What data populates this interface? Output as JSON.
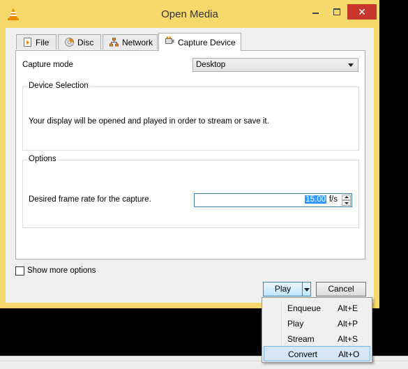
{
  "window": {
    "title": "Open Media"
  },
  "tabs": [
    {
      "label": "File",
      "icon": "file-play-icon"
    },
    {
      "label": "Disc",
      "icon": "disc-icon"
    },
    {
      "label": "Network",
      "icon": "network-icon"
    },
    {
      "label": "Capture Device",
      "icon": "capture-device-icon"
    }
  ],
  "capture": {
    "mode_label": "Capture mode",
    "mode_value": "Desktop",
    "device_selection_title": "Device Selection",
    "device_selection_text": "Your display will be opened and played in order to stream or save it.",
    "options_title": "Options",
    "frame_rate_label": "Desired frame rate for the capture.",
    "frame_rate_value": "15.00",
    "frame_rate_unit": "f/s"
  },
  "show_more": {
    "label": "Show more options",
    "checked": false
  },
  "buttons": {
    "play": "Play",
    "cancel": "Cancel"
  },
  "play_menu": [
    {
      "label": "Enqueue",
      "shortcut": "Alt+E"
    },
    {
      "label": "Play",
      "shortcut": "Alt+P"
    },
    {
      "label": "Stream",
      "shortcut": "Alt+S"
    },
    {
      "label": "Convert",
      "shortcut": "Alt+O"
    }
  ],
  "colors": {
    "title_bar": "#f6d96b",
    "close_button": "#c7352c",
    "selection": "#3399ff",
    "menu_highlight": "#d5e6f7"
  }
}
